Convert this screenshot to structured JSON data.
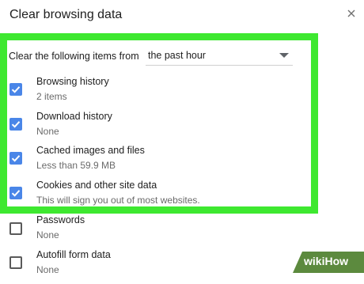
{
  "dialog": {
    "title": "Clear browsing data",
    "close_icon": "close-icon"
  },
  "range": {
    "label": "Clear the following items from",
    "value": "the past hour"
  },
  "items": [
    {
      "title": "Browsing history",
      "sub": "2 items",
      "checked": true
    },
    {
      "title": "Download history",
      "sub": "None",
      "checked": true
    },
    {
      "title": "Cached images and files",
      "sub": "Less than 59.9 MB",
      "checked": true
    },
    {
      "title": "Cookies and other site data",
      "sub": "This will sign you out of most websites.",
      "checked": true
    },
    {
      "title": "Passwords",
      "sub": "None",
      "checked": false
    },
    {
      "title": "Autofill form data",
      "sub": "None",
      "checked": false
    }
  ],
  "watermark": {
    "text": "wikiHow"
  },
  "colors": {
    "highlight": "#3ee830",
    "checkbox": "#4a86e8",
    "watermark": "#5c8a3e"
  }
}
